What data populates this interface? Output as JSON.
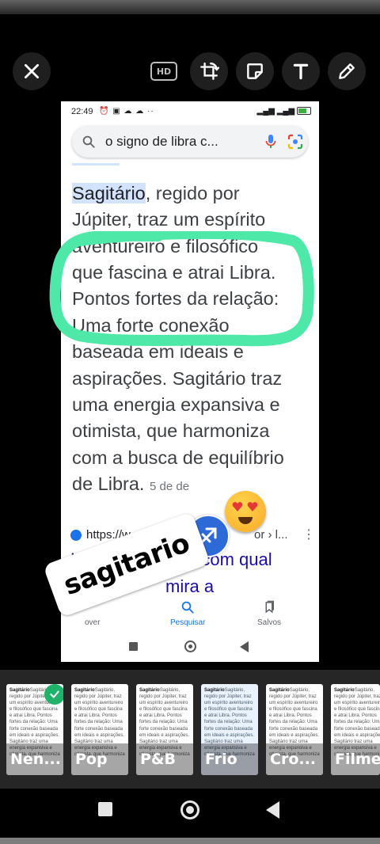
{
  "editor": {
    "toolbar": {
      "hd_label": "HD",
      "close_icon": "close-icon",
      "crop_icon": "crop-rotate-icon",
      "sticker_icon": "sticker-icon",
      "text_icon": "text-icon",
      "draw_icon": "pencil-icon"
    },
    "sticker_text": "sagitario",
    "emoji": "heart-eyes-emoji",
    "symbol": "sagittarius-symbol",
    "filters": [
      {
        "label": "Nen...",
        "selected": true
      },
      {
        "label": "Pop",
        "selected": false
      },
      {
        "label": "P&B",
        "selected": false
      },
      {
        "label": "Frio",
        "selected": false
      },
      {
        "label": "Cro...",
        "selected": false
      },
      {
        "label": "Filme",
        "selected": false
      }
    ],
    "filter_thumb_text": "Sagitário, regido por Júpiter, traz um espírito aventureiro e filosófico que fascina e atrai Libra. Pontos fortes da relação: Uma forte conexão baseada em ideais e aspirações. Sagitário traz uma energia expansiva e otimista, que harmoniza"
  },
  "screenshot": {
    "status": {
      "time": "22:49"
    },
    "search": {
      "query": "o signo de libra c..."
    },
    "article": {
      "highlight": "Sagitário",
      "line1_rest": ", regido por",
      "line2": "Júpiter, traz um espírito",
      "line3": "aventureiro e filosófico",
      "line4": "que fascina e atrai Libra.",
      "line5": "Pontos fortes da relação:",
      "line6": "Uma forte conexão",
      "line7": "baseada em ideais e",
      "line8": "aspirações. Sagitário traz",
      "line9": "uma energia expansiva e",
      "line10": "otimista, que harmoniza",
      "line11": "com a busca de equilíbrio",
      "line12": "de Libra.",
      "date": "5 de de"
    },
    "result": {
      "url": "https://w",
      "breadcrumb": "or › l...",
      "title": "Lib",
      "title_end": "com qual",
      "title_line2": "mira a"
    },
    "bottom_nav": {
      "discover": "over",
      "search": "Pesquisar",
      "saved": "Salvos"
    }
  },
  "colors": {
    "highlight_marker": "#4ee8a8",
    "link": "#1a0dab",
    "accent": "#1a73e8",
    "selected_check": "#1fb36a"
  }
}
